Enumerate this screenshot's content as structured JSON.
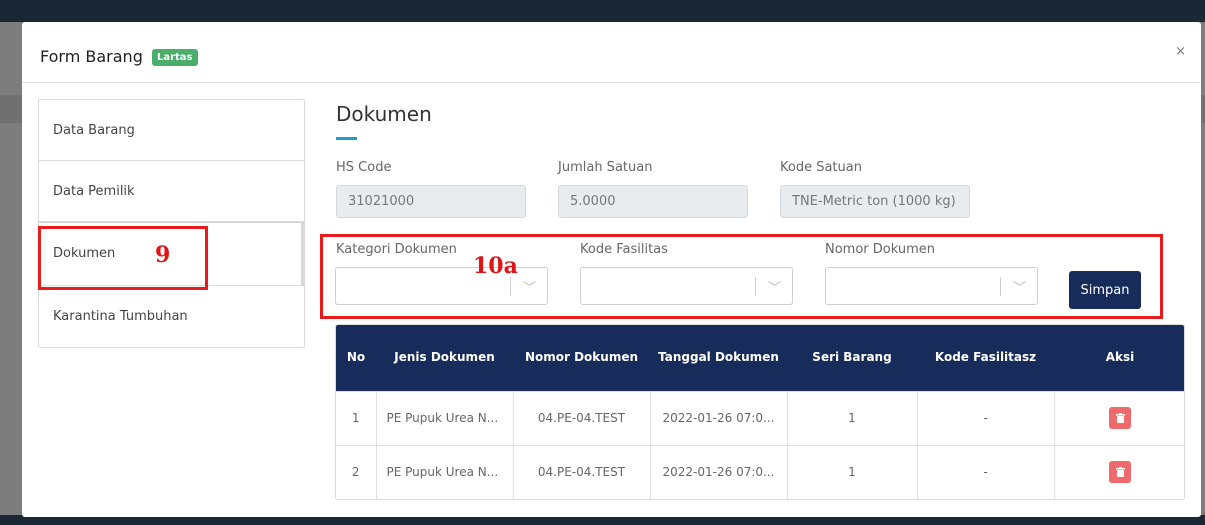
{
  "modal": {
    "title": "Form Barang",
    "badge": "Lartas",
    "close": "×"
  },
  "sidebar": {
    "items": [
      {
        "label": "Data Barang"
      },
      {
        "label": "Data Pemilik"
      },
      {
        "label": "Dokumen"
      },
      {
        "label": "Karantina Tumbuhan"
      }
    ]
  },
  "section": {
    "title": "Dokumen",
    "hs_code": {
      "label": "HS Code",
      "value": "31021000"
    },
    "jumlah_satuan": {
      "label": "Jumlah Satuan",
      "value": "5.0000"
    },
    "kode_satuan": {
      "label": "Kode Satuan",
      "value": "TNE-Metric ton (1000 kg)"
    }
  },
  "filters": {
    "kategori": {
      "label": "Kategori Dokumen",
      "value": ""
    },
    "kode_fasilitas": {
      "label": "Kode Fasilitas",
      "value": ""
    },
    "nomor_dokumen": {
      "label": "Nomor Dokumen",
      "value": ""
    },
    "save_label": "Simpan"
  },
  "annotations": {
    "a9": "9",
    "a10a": "10a"
  },
  "table": {
    "headers": [
      "No",
      "Jenis Dokumen",
      "Nomor Dokumen",
      "Tanggal Dokumen",
      "Seri Barang",
      "Kode Fasilitasz",
      "Aksi"
    ],
    "rows": [
      {
        "no": "1",
        "jenis": "PE Pupuk Urea N...",
        "nomor": "04.PE-04.TEST",
        "tanggal": "2022-01-26 07:0...",
        "seri": "1",
        "fasilitas": "-"
      },
      {
        "no": "2",
        "jenis": "PE Pupuk Urea N...",
        "nomor": "04.PE-04.TEST",
        "tanggal": "2022-01-26 07:0...",
        "seri": "1",
        "fasilitas": "-"
      }
    ]
  },
  "colors": {
    "navy": "#172c5a",
    "badge_green": "#4cae6a",
    "accent_blue": "#1a9ec7",
    "highlight_red": "#e81c1c",
    "delete_red": "#ef6b6b"
  },
  "icons": {
    "close": "close-icon",
    "chevron": "chevron-down-icon",
    "delete": "trash-icon"
  }
}
